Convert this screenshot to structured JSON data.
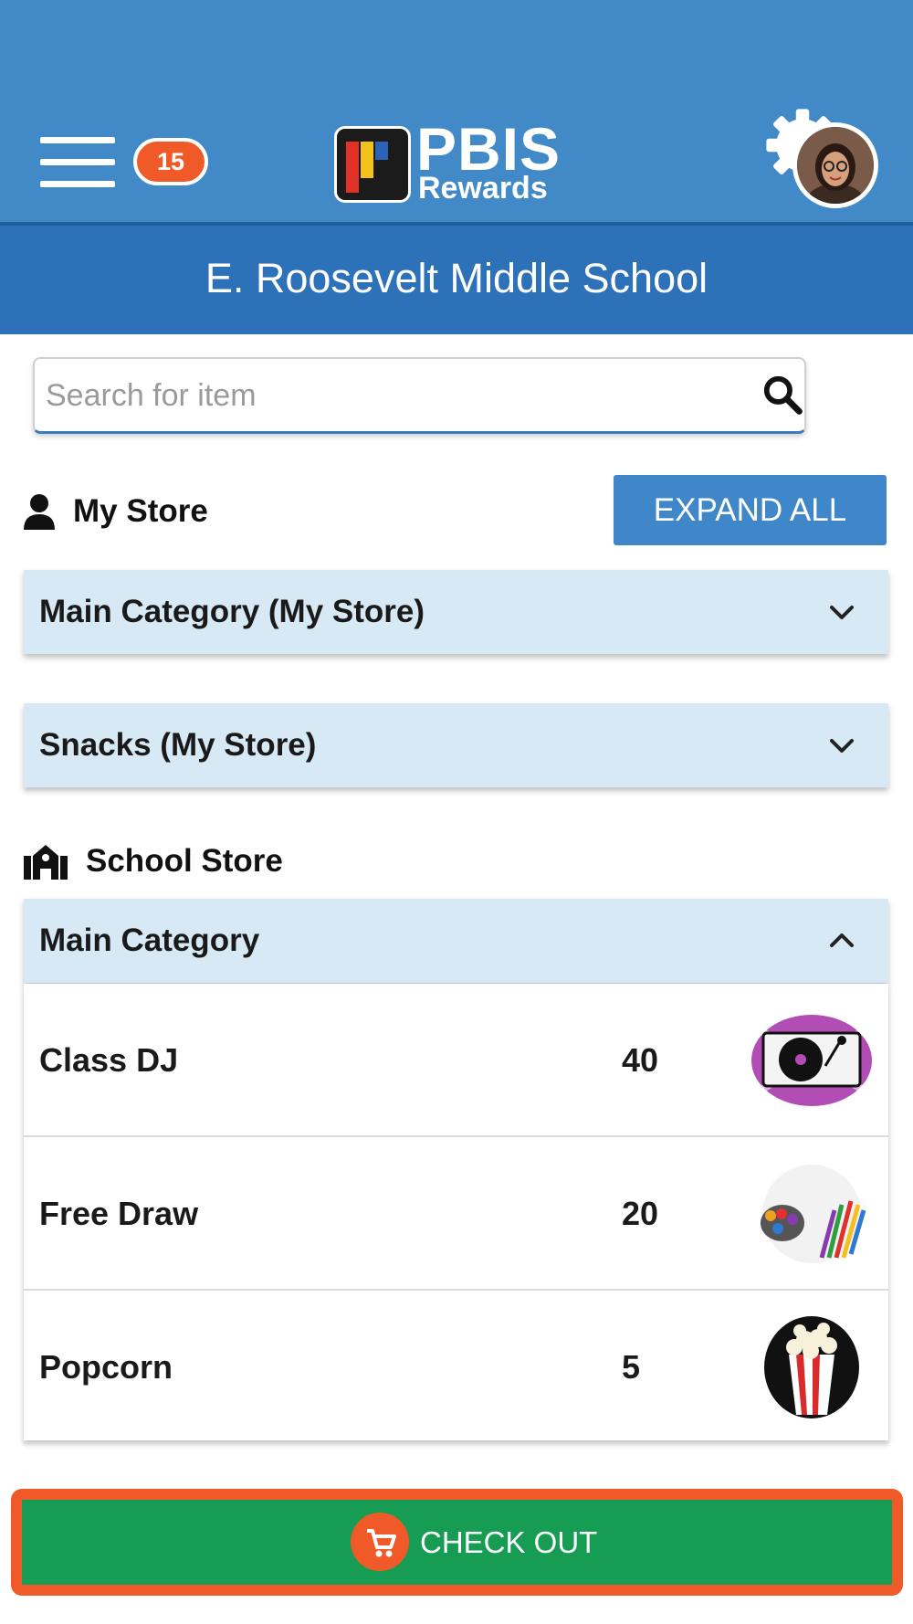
{
  "header": {
    "notification_count": "15",
    "logo_text_main": "PBIS",
    "logo_text_sub": "Rewards",
    "school_name": "E. Roosevelt Middle School",
    "icons": {
      "menu": "hamburger-menu-icon",
      "settings": "gear-icon",
      "profile": "avatar"
    }
  },
  "search": {
    "placeholder": "Search for item",
    "value": ""
  },
  "my_store": {
    "title": "My Store",
    "expand_all_label": "EXPAND ALL",
    "categories": [
      {
        "label": "Main Category (My Store)",
        "expanded": false
      },
      {
        "label": "Snacks (My Store)",
        "expanded": false
      }
    ]
  },
  "school_store": {
    "title": "School Store",
    "category": {
      "label": "Main Category",
      "expanded": true
    },
    "items": [
      {
        "name": "Class DJ",
        "price": "40",
        "image": "turntable"
      },
      {
        "name": "Free Draw",
        "price": "20",
        "image": "colored-pencils"
      },
      {
        "name": "Popcorn",
        "price": "5",
        "image": "popcorn"
      }
    ]
  },
  "checkout": {
    "label": "CHECK OUT",
    "icon": "cart-icon"
  },
  "colors": {
    "header_blue": "#4289c8",
    "school_bar_blue": "#2d72b8",
    "accent_orange": "#f05a28",
    "accordion_bg": "#d7e9f5",
    "checkout_green": "#169c53"
  }
}
